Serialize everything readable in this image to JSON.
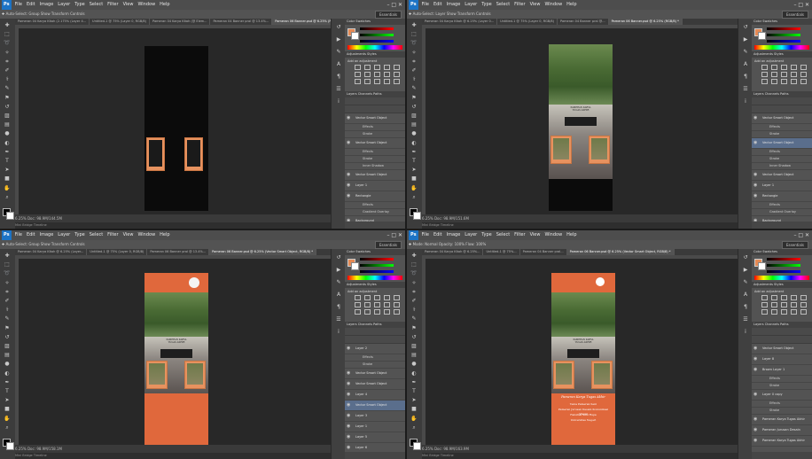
{
  "app": {
    "name": "Ps"
  },
  "menu": [
    "File",
    "Edit",
    "Image",
    "Layer",
    "Type",
    "Select",
    "Filter",
    "View",
    "Window",
    "Help"
  ],
  "windows": [
    {
      "workspace": "Essentials",
      "options": "Auto-Select:  Group   Show Transform Controls",
      "tabs": [
        "Pameran 04 Karya Kitah (2.175% (Layer 4...",
        "Untitled-1 @ 75% (Layer 0, RGB/8)",
        "Pameran 04 Karya Kitah (@ Elem...",
        "Pameran 04 Banner pral @ 13.4%...",
        "Pameran 06 Banner.psd @ 6.25% (RGB/8) *"
      ],
      "active_tab": 4,
      "status": "6.25%   Doc: 98.9M/144.5M",
      "status2": "Mini Bridge   Timeline",
      "panel_tabs": {
        "color": "Color   Swatches",
        "adjust": "Adjustments   Styles",
        "adjust_label": "Add an adjustment",
        "layers": "Layers   Channels   Paths"
      },
      "layers": [
        {
          "name": "Vector Smart Object",
          "sub": false,
          "sel": false
        },
        {
          "name": "Effects",
          "sub": true,
          "sel": false
        },
        {
          "name": "Stroke",
          "sub": true,
          "sel": false
        },
        {
          "name": "Vector Smart Object",
          "sub": false,
          "sel": false
        },
        {
          "name": "Effects",
          "sub": true,
          "sel": false
        },
        {
          "name": "Stroke",
          "sub": true,
          "sel": false
        },
        {
          "name": "Inner Shadow",
          "sub": true,
          "sel": false
        },
        {
          "name": "Vector Smart Object",
          "sub": false,
          "sel": false
        },
        {
          "name": "Layer 1",
          "sub": false,
          "sel": false
        },
        {
          "name": "Rectangle",
          "sub": false,
          "sel": false
        },
        {
          "name": "Effects",
          "sub": true,
          "sel": false
        },
        {
          "name": "Gradient Overlay",
          "sub": true,
          "sel": false
        },
        {
          "name": "Background",
          "sub": false,
          "sel": false
        }
      ]
    },
    {
      "workspace": "Essentials",
      "options": "Auto-Select:  Layer   Show Transform Controls",
      "tabs": [
        "Pameran 04 Karya Kitah @ 6.25% (Layer 0...",
        "Untitled-1 @ 75% (Layer 0, RGB/8)",
        "Pameran 04 Banner pral @...",
        "Pameran 06 Banner.psd @ 6.25% (RGB/8) *"
      ],
      "active_tab": 3,
      "status": "6.25%   Doc: 98.9M/151.6M",
      "status2": "Mini Bridge   Timeline",
      "panel_tabs": {
        "color": "Color   Swatches",
        "adjust": "Adjustments   Styles",
        "adjust_label": "Add an adjustment",
        "layers": "Layers   Channels   Paths"
      },
      "layers": [
        {
          "name": "Vector Smart Object",
          "sub": false,
          "sel": false
        },
        {
          "name": "Effects",
          "sub": true,
          "sel": false
        },
        {
          "name": "Stroke",
          "sub": true,
          "sel": false
        },
        {
          "name": "Vector Smart Object",
          "sub": false,
          "sel": true
        },
        {
          "name": "Effects",
          "sub": true,
          "sel": false
        },
        {
          "name": "Stroke",
          "sub": true,
          "sel": false
        },
        {
          "name": "Inner Shadow",
          "sub": true,
          "sel": false
        },
        {
          "name": "Vector Smart Object",
          "sub": false,
          "sel": false
        },
        {
          "name": "Layer 1",
          "sub": false,
          "sel": false
        },
        {
          "name": "Rectangle",
          "sub": false,
          "sel": false
        },
        {
          "name": "Effects",
          "sub": true,
          "sel": false
        },
        {
          "name": "Gradient Overlay",
          "sub": true,
          "sel": false
        },
        {
          "name": "Background",
          "sub": false,
          "sel": false
        }
      ]
    },
    {
      "workspace": "Essentials",
      "options": "Auto-Select:  Group   Show Transform Controls",
      "tabs": [
        "Pameran 04 Karya Kitah @ 6.25% (Layer...",
        "Untitled-1 @ 75% (Layer 0, RGB/8)",
        "Pameran 06 Banner pral @ 13.4%...",
        "Pameran 06 Banner.psd @ 6.25% (Vector Smart Object, RGB/8) *"
      ],
      "active_tab": 3,
      "status": "6.25%   Doc: 98.9M/158.1M",
      "status2": "Mini Bridge   Timeline",
      "panel_tabs": {
        "color": "Color   Swatches",
        "adjust": "Adjustments   Styles",
        "adjust_label": "Add an adjustment",
        "layers": "Layers   Channels   Paths"
      },
      "layers": [
        {
          "name": "Layer 2",
          "sub": false,
          "sel": false
        },
        {
          "name": "Effects",
          "sub": true,
          "sel": false
        },
        {
          "name": "Stroke",
          "sub": true,
          "sel": false
        },
        {
          "name": "Vector Smart Object",
          "sub": false,
          "sel": false
        },
        {
          "name": "Vector Smart Object",
          "sub": false,
          "sel": false
        },
        {
          "name": "Layer 4",
          "sub": false,
          "sel": false
        },
        {
          "name": "Vector Smart Object",
          "sub": false,
          "sel": true
        },
        {
          "name": "Layer 3",
          "sub": false,
          "sel": false
        },
        {
          "name": "Layer 1",
          "sub": false,
          "sel": false
        },
        {
          "name": "Layer 5",
          "sub": false,
          "sel": false
        },
        {
          "name": "Layer 6",
          "sub": false,
          "sel": false
        },
        {
          "name": "Layer 7",
          "sub": false,
          "sel": false
        }
      ]
    },
    {
      "workspace": "Essentials",
      "options": "Mode: Normal   Opacity: 100%   Flow: 100%",
      "tabs": [
        "Pameran 04 Karya Kitah @ 6.25%...",
        "Untitled-1 @ 75%...",
        "Pameran 04 Banner pral...",
        "Pameran 06 Banner.psd @ 6.25% (Vector Smart Object, RGB/8) *"
      ],
      "active_tab": 3,
      "status": "6.25%   Doc: 98.9M/163.9M",
      "status2": "Mini Bridge   Timeline",
      "panel_tabs": {
        "color": "Color   Swatches",
        "adjust": "Adjustments   Styles",
        "adjust_label": "Add an adjustment",
        "layers": "Layers   Channels   Paths"
      },
      "layers": [
        {
          "name": "Vector Smart Object",
          "sub": false,
          "sel": false
        },
        {
          "name": "Layer 8",
          "sub": false,
          "sel": false
        },
        {
          "name": "Brown Layer 1",
          "sub": false,
          "sel": false
        },
        {
          "name": "Effects",
          "sub": true,
          "sel": false
        },
        {
          "name": "Stroke",
          "sub": true,
          "sel": false
        },
        {
          "name": "Layer 0 copy",
          "sub": false,
          "sel": false
        },
        {
          "name": "Effects",
          "sub": true,
          "sel": false
        },
        {
          "name": "Stroke",
          "sub": true,
          "sel": false
        },
        {
          "name": "Pameran Karya Tugas Akhir",
          "sub": false,
          "sel": false
        },
        {
          "name": "Pameran Jurusan Desain",
          "sub": false,
          "sel": false
        },
        {
          "name": "Pameran Karya Tugas Akhir",
          "sub": false,
          "sel": false
        }
      ]
    }
  ],
  "banner_text": {
    "title_small": "PAMERAN KARYA",
    "subtitle_small": "TUGAS AKHIR",
    "heading": "Pameran Karya Tugas Akhir",
    "lines": [
      "Tema Pameran Seni",
      "Pameran Jurusan Desain Komunikasi Visual",
      "Fakultas Seni Rupa",
      "Universitas Negeri"
    ]
  },
  "colors": {
    "accent_orange": "#e0683c",
    "frame_orange": "#e7925f",
    "selection_blue": "#5a6e8c"
  }
}
